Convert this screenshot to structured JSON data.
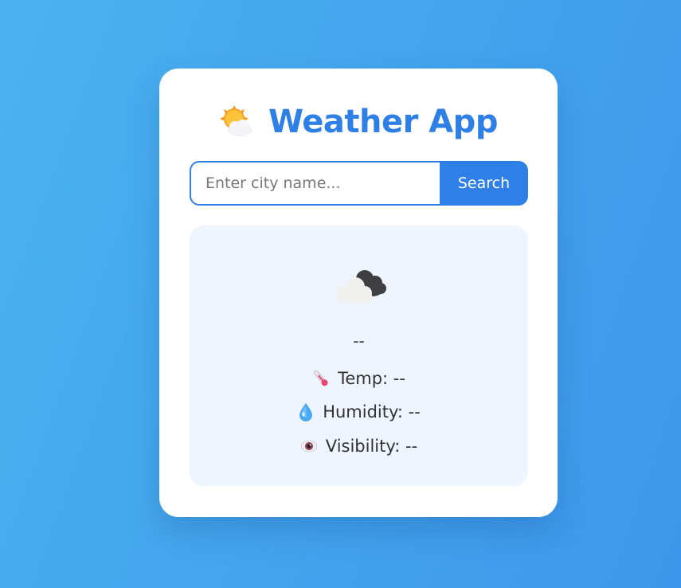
{
  "app": {
    "title": "Weather App",
    "title_icon": "sun-behind-cloud-icon"
  },
  "search": {
    "placeholder": "Enter city name...",
    "value": "",
    "button_label": "Search"
  },
  "result": {
    "weather_icon": "cloud-icon",
    "description": "--",
    "temp_label": "Temp:",
    "temp_value": "--",
    "temp_text": "Temp: --",
    "temp_icon": "thermometer-icon",
    "humidity_label": "Humidity:",
    "humidity_value": "--",
    "humidity_text": "Humidity: --",
    "humidity_icon": "droplet-icon",
    "visibility_label": "Visibility:",
    "visibility_value": "--",
    "visibility_text": "Visibility: --",
    "visibility_icon": "eye-icon"
  },
  "colors": {
    "accent": "#2f80e6",
    "background_start": "#4ab3ef",
    "background_end": "#3d97ec",
    "panel": "#eef5ff"
  }
}
